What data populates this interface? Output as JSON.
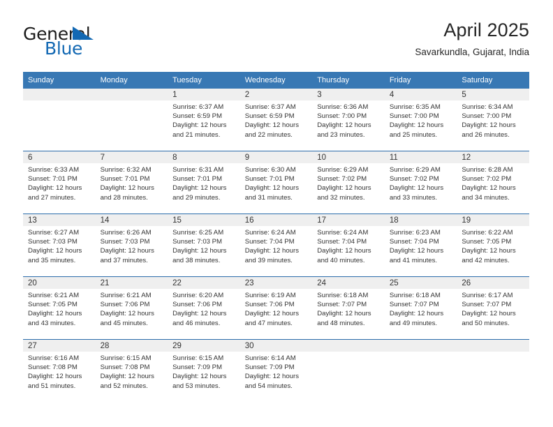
{
  "brand": {
    "name_part1": "General",
    "name_part2": "Blue",
    "accent_color": "#1268b3"
  },
  "header": {
    "title": "April 2025",
    "subtitle": "Savarkundla, Gujarat, India"
  },
  "calendar": {
    "header_bg": "#3878b4",
    "row_divider_color": "#2b6cab",
    "daynum_bg": "#efefef",
    "weekdays": [
      "Sunday",
      "Monday",
      "Tuesday",
      "Wednesday",
      "Thursday",
      "Friday",
      "Saturday"
    ],
    "weeks": [
      [
        {
          "day": "",
          "lines": []
        },
        {
          "day": "",
          "lines": []
        },
        {
          "day": "1",
          "lines": [
            "Sunrise: 6:37 AM",
            "Sunset: 6:59 PM",
            "Daylight: 12 hours",
            "and 21 minutes."
          ]
        },
        {
          "day": "2",
          "lines": [
            "Sunrise: 6:37 AM",
            "Sunset: 6:59 PM",
            "Daylight: 12 hours",
            "and 22 minutes."
          ]
        },
        {
          "day": "3",
          "lines": [
            "Sunrise: 6:36 AM",
            "Sunset: 7:00 PM",
            "Daylight: 12 hours",
            "and 23 minutes."
          ]
        },
        {
          "day": "4",
          "lines": [
            "Sunrise: 6:35 AM",
            "Sunset: 7:00 PM",
            "Daylight: 12 hours",
            "and 25 minutes."
          ]
        },
        {
          "day": "5",
          "lines": [
            "Sunrise: 6:34 AM",
            "Sunset: 7:00 PM",
            "Daylight: 12 hours",
            "and 26 minutes."
          ]
        }
      ],
      [
        {
          "day": "6",
          "lines": [
            "Sunrise: 6:33 AM",
            "Sunset: 7:01 PM",
            "Daylight: 12 hours",
            "and 27 minutes."
          ]
        },
        {
          "day": "7",
          "lines": [
            "Sunrise: 6:32 AM",
            "Sunset: 7:01 PM",
            "Daylight: 12 hours",
            "and 28 minutes."
          ]
        },
        {
          "day": "8",
          "lines": [
            "Sunrise: 6:31 AM",
            "Sunset: 7:01 PM",
            "Daylight: 12 hours",
            "and 29 minutes."
          ]
        },
        {
          "day": "9",
          "lines": [
            "Sunrise: 6:30 AM",
            "Sunset: 7:01 PM",
            "Daylight: 12 hours",
            "and 31 minutes."
          ]
        },
        {
          "day": "10",
          "lines": [
            "Sunrise: 6:29 AM",
            "Sunset: 7:02 PM",
            "Daylight: 12 hours",
            "and 32 minutes."
          ]
        },
        {
          "day": "11",
          "lines": [
            "Sunrise: 6:29 AM",
            "Sunset: 7:02 PM",
            "Daylight: 12 hours",
            "and 33 minutes."
          ]
        },
        {
          "day": "12",
          "lines": [
            "Sunrise: 6:28 AM",
            "Sunset: 7:02 PM",
            "Daylight: 12 hours",
            "and 34 minutes."
          ]
        }
      ],
      [
        {
          "day": "13",
          "lines": [
            "Sunrise: 6:27 AM",
            "Sunset: 7:03 PM",
            "Daylight: 12 hours",
            "and 35 minutes."
          ]
        },
        {
          "day": "14",
          "lines": [
            "Sunrise: 6:26 AM",
            "Sunset: 7:03 PM",
            "Daylight: 12 hours",
            "and 37 minutes."
          ]
        },
        {
          "day": "15",
          "lines": [
            "Sunrise: 6:25 AM",
            "Sunset: 7:03 PM",
            "Daylight: 12 hours",
            "and 38 minutes."
          ]
        },
        {
          "day": "16",
          "lines": [
            "Sunrise: 6:24 AM",
            "Sunset: 7:04 PM",
            "Daylight: 12 hours",
            "and 39 minutes."
          ]
        },
        {
          "day": "17",
          "lines": [
            "Sunrise: 6:24 AM",
            "Sunset: 7:04 PM",
            "Daylight: 12 hours",
            "and 40 minutes."
          ]
        },
        {
          "day": "18",
          "lines": [
            "Sunrise: 6:23 AM",
            "Sunset: 7:04 PM",
            "Daylight: 12 hours",
            "and 41 minutes."
          ]
        },
        {
          "day": "19",
          "lines": [
            "Sunrise: 6:22 AM",
            "Sunset: 7:05 PM",
            "Daylight: 12 hours",
            "and 42 minutes."
          ]
        }
      ],
      [
        {
          "day": "20",
          "lines": [
            "Sunrise: 6:21 AM",
            "Sunset: 7:05 PM",
            "Daylight: 12 hours",
            "and 43 minutes."
          ]
        },
        {
          "day": "21",
          "lines": [
            "Sunrise: 6:21 AM",
            "Sunset: 7:06 PM",
            "Daylight: 12 hours",
            "and 45 minutes."
          ]
        },
        {
          "day": "22",
          "lines": [
            "Sunrise: 6:20 AM",
            "Sunset: 7:06 PM",
            "Daylight: 12 hours",
            "and 46 minutes."
          ]
        },
        {
          "day": "23",
          "lines": [
            "Sunrise: 6:19 AM",
            "Sunset: 7:06 PM",
            "Daylight: 12 hours",
            "and 47 minutes."
          ]
        },
        {
          "day": "24",
          "lines": [
            "Sunrise: 6:18 AM",
            "Sunset: 7:07 PM",
            "Daylight: 12 hours",
            "and 48 minutes."
          ]
        },
        {
          "day": "25",
          "lines": [
            "Sunrise: 6:18 AM",
            "Sunset: 7:07 PM",
            "Daylight: 12 hours",
            "and 49 minutes."
          ]
        },
        {
          "day": "26",
          "lines": [
            "Sunrise: 6:17 AM",
            "Sunset: 7:07 PM",
            "Daylight: 12 hours",
            "and 50 minutes."
          ]
        }
      ],
      [
        {
          "day": "27",
          "lines": [
            "Sunrise: 6:16 AM",
            "Sunset: 7:08 PM",
            "Daylight: 12 hours",
            "and 51 minutes."
          ]
        },
        {
          "day": "28",
          "lines": [
            "Sunrise: 6:15 AM",
            "Sunset: 7:08 PM",
            "Daylight: 12 hours",
            "and 52 minutes."
          ]
        },
        {
          "day": "29",
          "lines": [
            "Sunrise: 6:15 AM",
            "Sunset: 7:09 PM",
            "Daylight: 12 hours",
            "and 53 minutes."
          ]
        },
        {
          "day": "30",
          "lines": [
            "Sunrise: 6:14 AM",
            "Sunset: 7:09 PM",
            "Daylight: 12 hours",
            "and 54 minutes."
          ]
        },
        {
          "day": "",
          "lines": []
        },
        {
          "day": "",
          "lines": []
        },
        {
          "day": "",
          "lines": []
        }
      ]
    ]
  }
}
